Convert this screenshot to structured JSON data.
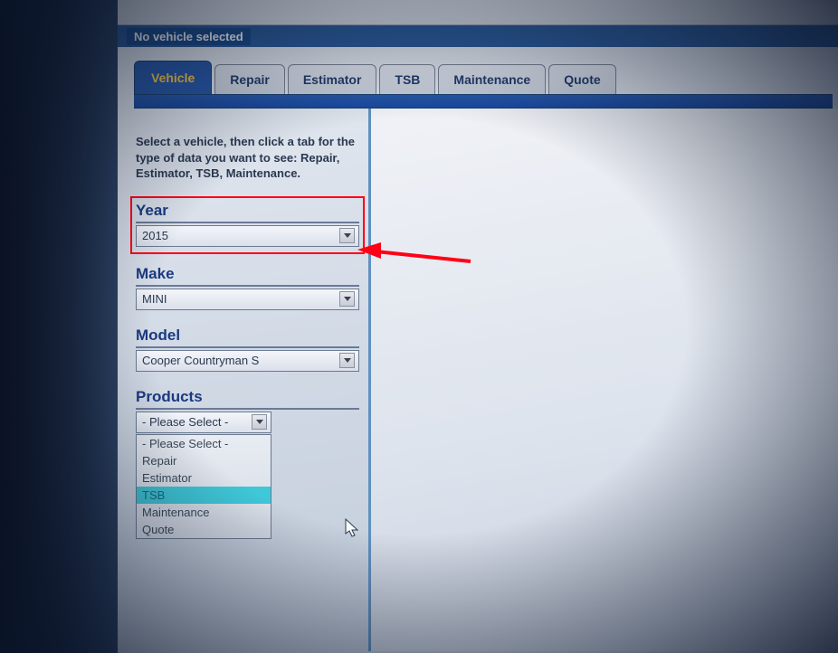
{
  "status": {
    "text": "No vehicle selected"
  },
  "tabs": [
    {
      "label": "Vehicle",
      "active": true
    },
    {
      "label": "Repair",
      "active": false
    },
    {
      "label": "Estimator",
      "active": false
    },
    {
      "label": "TSB",
      "active": false
    },
    {
      "label": "Maintenance",
      "active": false
    },
    {
      "label": "Quote",
      "active": false
    }
  ],
  "instructions": "Select a vehicle, then click a tab for the type of data you want to see: Repair, Estimator, TSB, Maintenance.",
  "fields": {
    "year": {
      "label": "Year",
      "value": "2015"
    },
    "make": {
      "label": "Make",
      "value": "MINI"
    },
    "model": {
      "label": "Model",
      "value": "Cooper Countryman S"
    },
    "products": {
      "label": "Products",
      "value": "- Please Select -"
    }
  },
  "products_options": [
    {
      "label": "- Please Select -",
      "highlighted": false
    },
    {
      "label": "Repair",
      "highlighted": false
    },
    {
      "label": "Estimator",
      "highlighted": false
    },
    {
      "label": "TSB",
      "highlighted": true
    },
    {
      "label": "Maintenance",
      "highlighted": false
    },
    {
      "label": "Quote",
      "highlighted": false
    }
  ]
}
